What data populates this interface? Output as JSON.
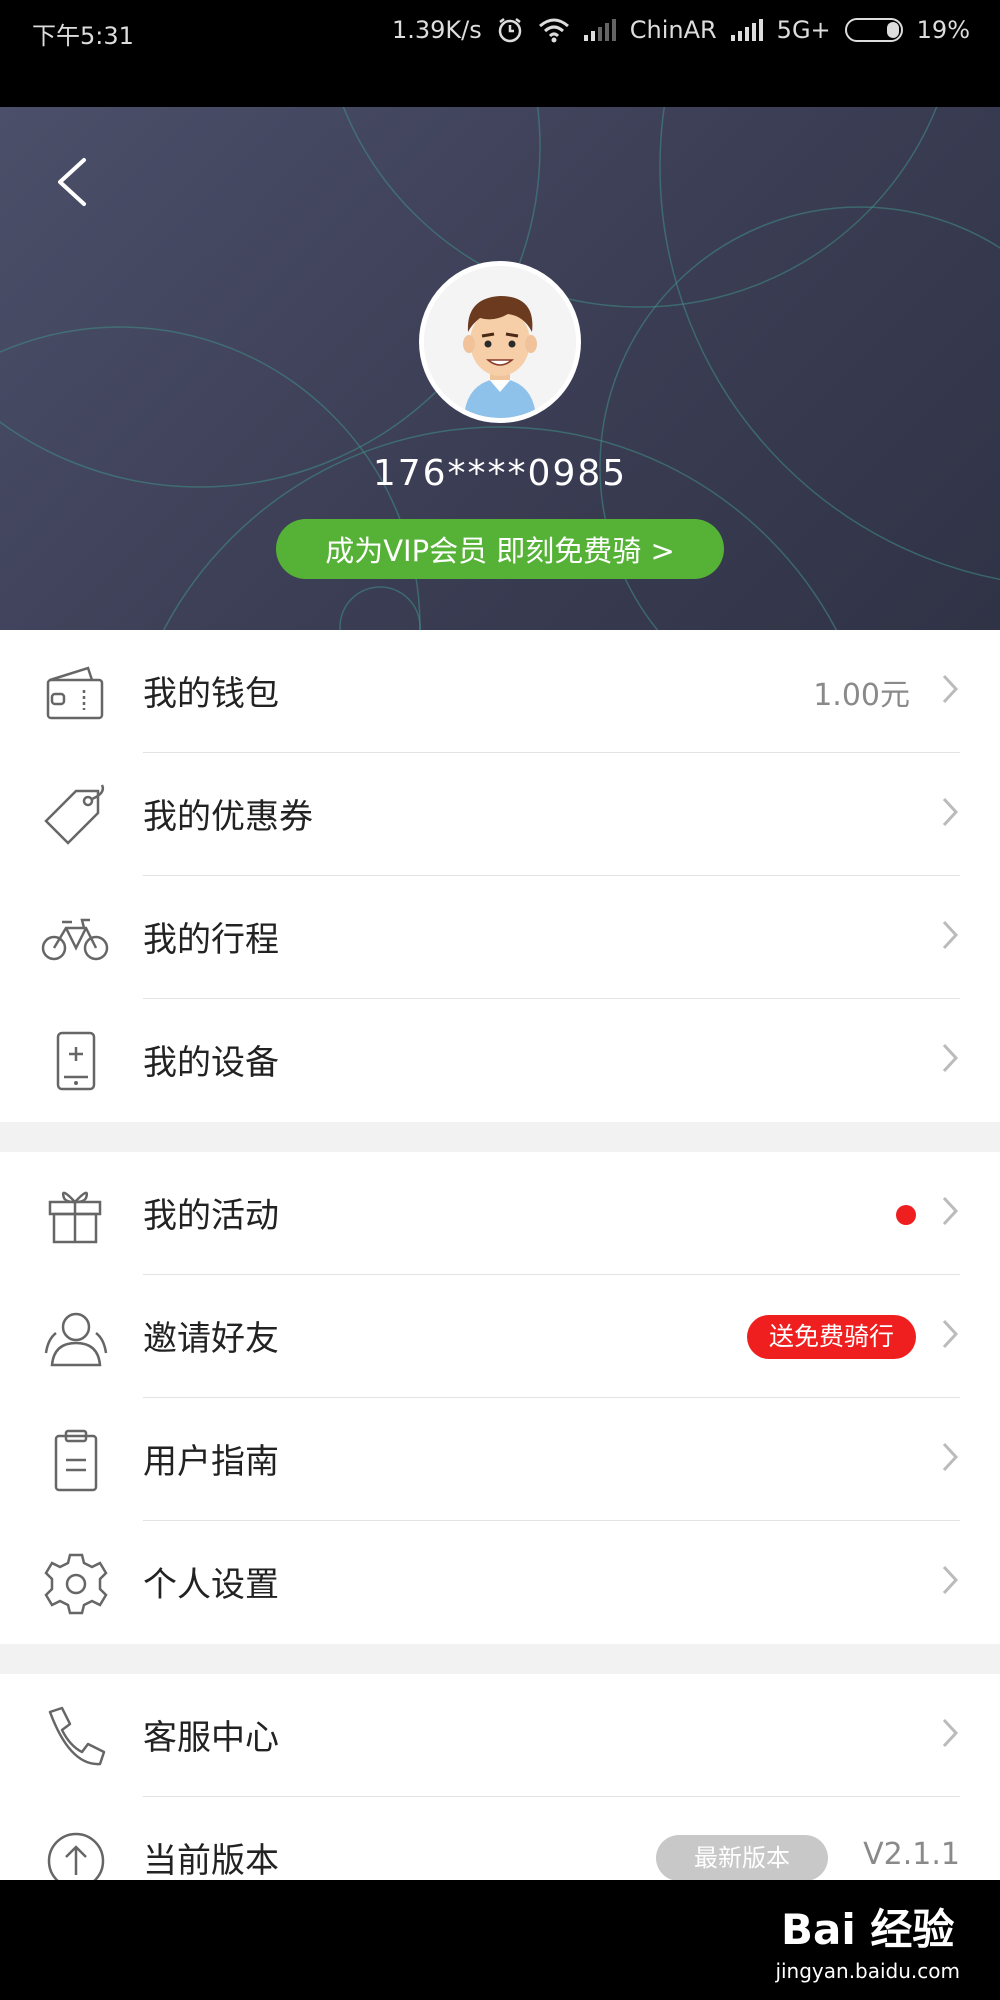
{
  "status_bar": {
    "time": "下午5:31",
    "speed": "1.39K/s",
    "carrier": "ChinAR",
    "network": "5G+",
    "battery": "19%",
    "icons": [
      "alarm-icon",
      "wifi-icon",
      "signal-icon",
      "signal-icon",
      "battery-icon"
    ]
  },
  "profile": {
    "phone": "176****0985",
    "vip_button": "成为VIP会员 即刻免费骑 >"
  },
  "menu": {
    "group1": [
      {
        "label": "我的钱包",
        "value": "1.00元",
        "icon": "wallet-icon"
      },
      {
        "label": "我的优惠券",
        "icon": "coupon-tag-icon"
      },
      {
        "label": "我的行程",
        "icon": "bicycle-icon"
      },
      {
        "label": "我的设备",
        "icon": "device-icon"
      }
    ],
    "group2": [
      {
        "label": "我的活动",
        "icon": "gift-icon",
        "has_dot": true
      },
      {
        "label": "邀请好友",
        "icon": "friends-icon",
        "badge": "送免费骑行"
      },
      {
        "label": "用户指南",
        "icon": "clipboard-icon"
      },
      {
        "label": "个人设置",
        "icon": "gear-icon"
      }
    ],
    "group3": [
      {
        "label": "客服中心",
        "icon": "phone-icon"
      },
      {
        "label": "当前版本",
        "icon": "upgrade-icon",
        "badge": "最新版本",
        "version": "V2.1.1"
      }
    ]
  },
  "colors": {
    "header_bg": "#3f4159",
    "vip_green": "#55b236",
    "alert_red": "#ef1f1f",
    "badge_grey": "#c8c8c8"
  },
  "watermark": {
    "main": "Bai 经验",
    "sub": "jingyan.baidu.com"
  }
}
